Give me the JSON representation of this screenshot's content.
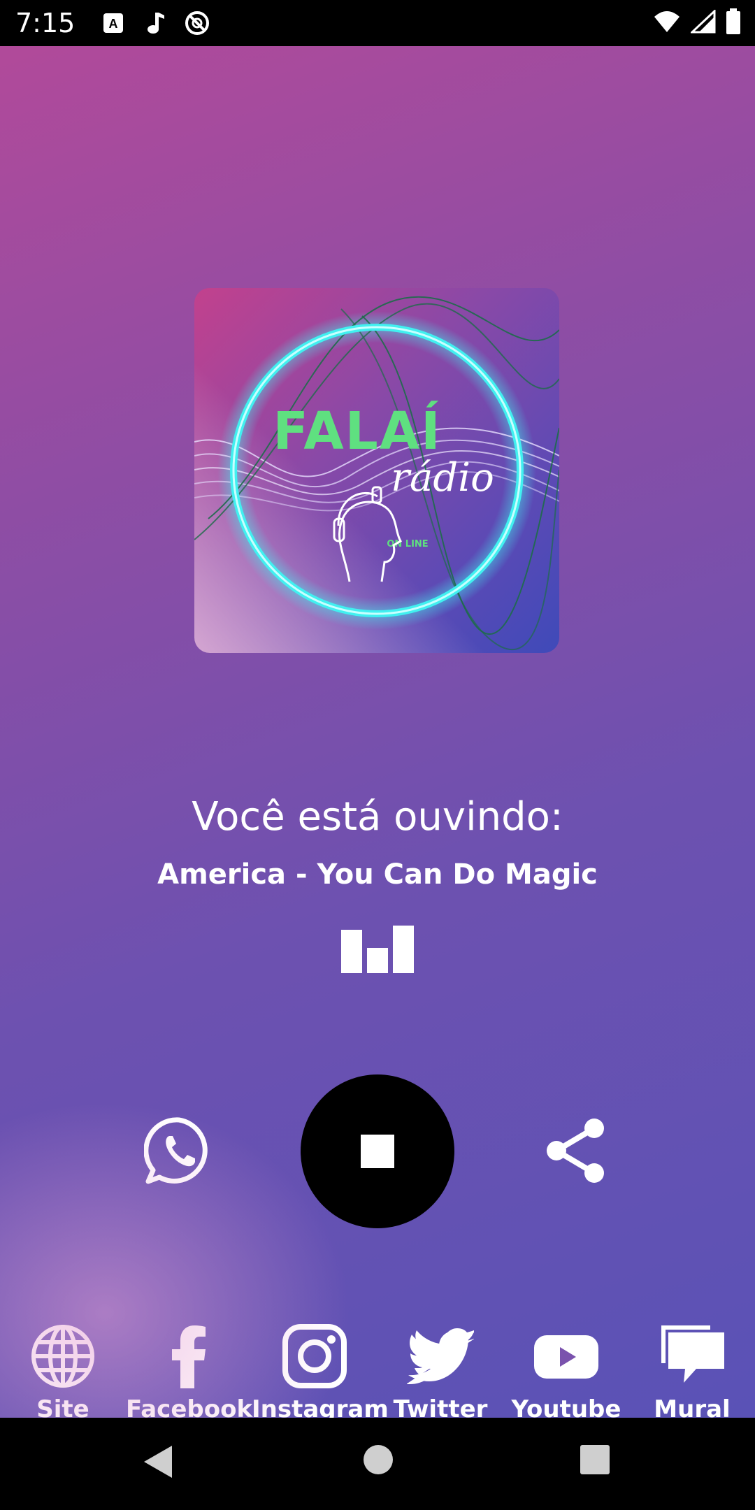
{
  "status_bar": {
    "time": "7:15",
    "icons": [
      "keyboard-a-icon",
      "music-note-icon",
      "no-sync-icon"
    ],
    "right_icons": [
      "wifi-icon",
      "signal-icon",
      "battery-icon"
    ]
  },
  "player": {
    "cover_art": {
      "logo_text": "FALAÍ",
      "logo_script": "rádio",
      "logo_subtext": "ON LINE"
    },
    "listening_label": "Você está ouvindo:",
    "track_title": "America - You Can Do Magic",
    "controls": {
      "left": "whatsapp-icon",
      "center": "stop-icon",
      "right": "share-icon"
    }
  },
  "links": [
    {
      "label": "Site",
      "icon": "globe-icon"
    },
    {
      "label": "Facebook",
      "icon": "facebook-icon"
    },
    {
      "label": "Instagram",
      "icon": "instagram-icon"
    },
    {
      "label": "Twitter",
      "icon": "twitter-icon"
    },
    {
      "label": "Youtube",
      "icon": "youtube-icon"
    },
    {
      "label": "Mural",
      "icon": "chat-bubbles-icon"
    }
  ],
  "colors": {
    "gradient_start": "#b14a9a",
    "gradient_end": "#5a52b6",
    "neon_ring": "#41f0f0",
    "logo_green": "#5fe080"
  }
}
